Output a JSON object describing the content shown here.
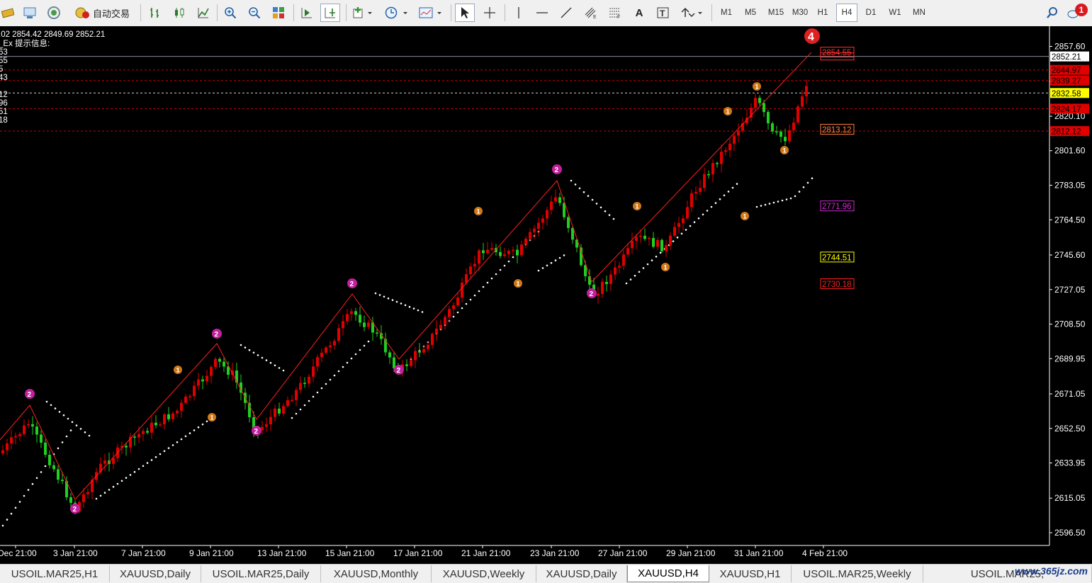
{
  "toolbar": {
    "auto_trade_label": "自动交易",
    "timeframes": [
      "M1",
      "M5",
      "M15",
      "M30",
      "H1",
      "H4",
      "D1",
      "W1",
      "MN"
    ],
    "active_timeframe": "H4",
    "notification_count": "1"
  },
  "chart": {
    "ohlc_header": ".02 2854.42 2849.69 2852.21",
    "indicator_label": "_Ex 提示信息:",
    "indicator_values": [
      "63",
      "55",
      "5",
      "43",
      "12",
      "96",
      "51",
      "18"
    ],
    "wave_label": "4",
    "price_axis": [
      "2857.60",
      "2838.85",
      "2820.10",
      "2801.60",
      "2783.05",
      "2764.50",
      "2745.60",
      "2727.05",
      "2708.50",
      "2689.95",
      "2671.05",
      "2652.50",
      "2633.95",
      "2615.05",
      "2596.50"
    ],
    "current_price": "2852.21",
    "axis_flags": [
      {
        "value": "2844.97",
        "color": "#e00000"
      },
      {
        "value": "2839.27",
        "color": "#e00000"
      },
      {
        "value": "2832.58",
        "color": "#ffff00"
      },
      {
        "value": "2824.17",
        "color": "#e00000"
      },
      {
        "value": "2812.12",
        "color": "#e00000"
      }
    ],
    "level_labels": [
      {
        "value": "2854.55",
        "color": "#ff3030"
      },
      {
        "value": "2813.12",
        "color": "#ff8040"
      },
      {
        "value": "2771.96",
        "color": "#d02ad0"
      },
      {
        "value": "2744.51",
        "color": "#ffff00"
      },
      {
        "value": "2730.18",
        "color": "#ff2020"
      }
    ],
    "time_axis": [
      "Dec 21:00",
      "3 Jan 21:00",
      "7 Jan 21:00",
      "9 Jan 21:00",
      "13 Jan 21:00",
      "15 Jan 21:00",
      "17 Jan 21:00",
      "21 Jan 21:00",
      "23 Jan 21:00",
      "27 Jan 21:00",
      "29 Jan 21:00",
      "31 Jan 21:00",
      "4 Feb 21:00"
    ],
    "colors": {
      "up": "#e00000",
      "down": "#20d020",
      "sar": "#ffffff",
      "zigzag": "#ff2020",
      "wave2": "#c0209c",
      "wave1": "#d07818"
    }
  },
  "tabs": [
    "USOIL.MAR25,H1",
    "XAUUSD,Daily",
    "USOIL.MAR25,Daily",
    "XAUUSD,Monthly",
    "XAUUSD,Weekly",
    "XAUUSD,Daily",
    "XAUUSD,H4",
    "XAUUSD,H1",
    "USOIL.MAR25,Weekly",
    "USOIL.MAR25,"
  ],
  "active_tab": "XAUUSD,H4",
  "watermark": "www.365jz.com"
}
